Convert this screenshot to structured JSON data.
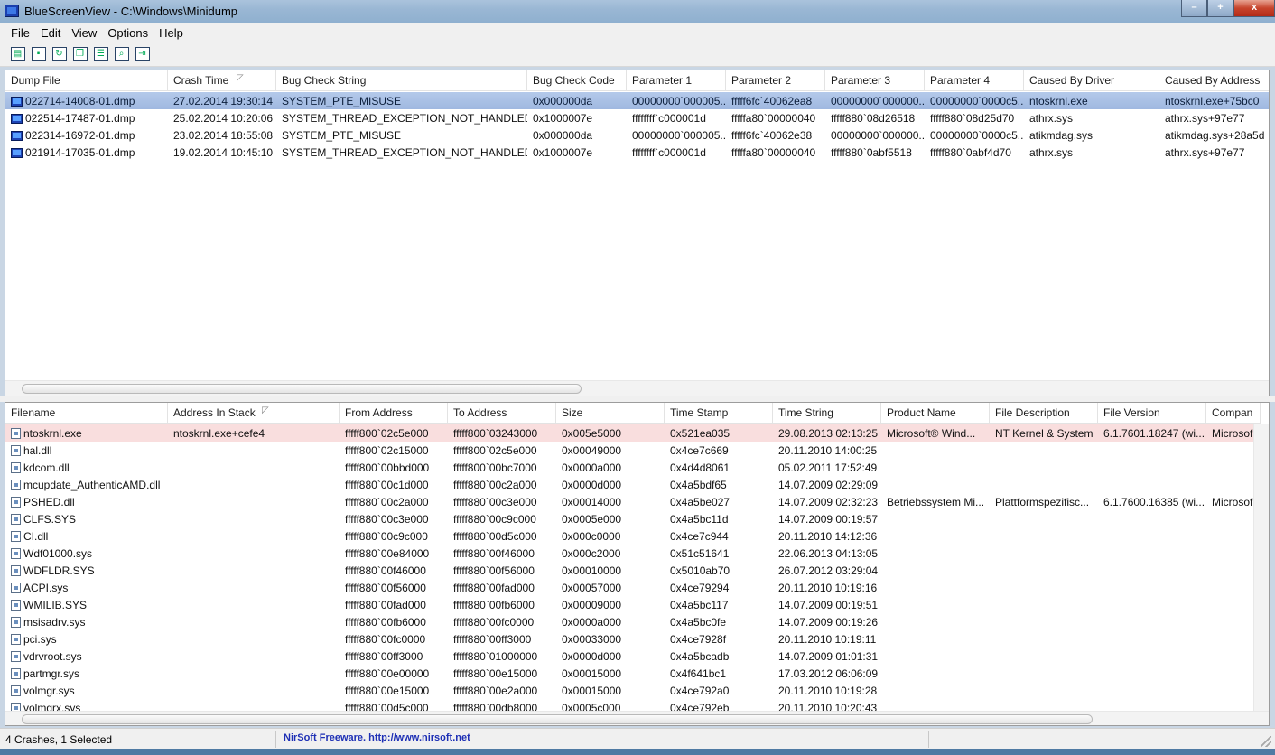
{
  "window": {
    "title": "BlueScreenView  -  C:\\Windows\\Minidump",
    "min": "–",
    "max": "+",
    "close": "x"
  },
  "menu": [
    "File",
    "Edit",
    "View",
    "Options",
    "Help"
  ],
  "toolbar": [
    {
      "name": "html-report-icon",
      "glyph": "▤"
    },
    {
      "name": "save-icon",
      "glyph": "▪"
    },
    {
      "name": "refresh-icon",
      "glyph": "↻"
    },
    {
      "name": "copy-icon",
      "glyph": "❐"
    },
    {
      "name": "properties-icon",
      "glyph": "☰"
    },
    {
      "name": "find-icon",
      "glyph": "⌕"
    },
    {
      "name": "exit-icon",
      "glyph": "⇥"
    }
  ],
  "crashes": {
    "columns": [
      "Dump File",
      "Crash Time",
      "Bug Check String",
      "Bug Check Code",
      "Parameter 1",
      "Parameter 2",
      "Parameter 3",
      "Parameter 4",
      "Caused By Driver",
      "Caused By Address"
    ],
    "rows": [
      [
        "022714-14008-01.dmp",
        "27.02.2014 19:30:14",
        "SYSTEM_PTE_MISUSE",
        "0x000000da",
        "00000000`000005...",
        "fffff6fc`40062ea8",
        "00000000`000000...",
        "00000000`0000c5...",
        "ntoskrnl.exe",
        "ntoskrnl.exe+75bc0"
      ],
      [
        "022514-17487-01.dmp",
        "25.02.2014 10:20:06",
        "SYSTEM_THREAD_EXCEPTION_NOT_HANDLED",
        "0x1000007e",
        "ffffffff`c000001d",
        "fffffa80`00000040",
        "fffff880`08d26518",
        "fffff880`08d25d70",
        "athrx.sys",
        "athrx.sys+97e77"
      ],
      [
        "022314-16972-01.dmp",
        "23.02.2014 18:55:08",
        "SYSTEM_PTE_MISUSE",
        "0x000000da",
        "00000000`000005...",
        "fffff6fc`40062e38",
        "00000000`000000...",
        "00000000`0000c5...",
        "atikmdag.sys",
        "atikmdag.sys+28a5d"
      ],
      [
        "021914-17035-01.dmp",
        "19.02.2014 10:45:10",
        "SYSTEM_THREAD_EXCEPTION_NOT_HANDLED",
        "0x1000007e",
        "ffffffff`c000001d",
        "fffffa80`00000040",
        "fffff880`0abf5518",
        "fffff880`0abf4d70",
        "athrx.sys",
        "athrx.sys+97e77"
      ]
    ]
  },
  "drivers": {
    "columns": [
      "Filename",
      "Address In Stack",
      "From Address",
      "To Address",
      "Size",
      "Time Stamp",
      "Time String",
      "Product Name",
      "File Description",
      "File Version",
      "Compan"
    ],
    "rows": [
      [
        "ntoskrnl.exe",
        "ntoskrnl.exe+cefe4",
        "fffff800`02c5e000",
        "fffff800`03243000",
        "0x005e5000",
        "0x521ea035",
        "29.08.2013 02:13:25",
        "Microsoft® Wind...",
        "NT Kernel & System",
        "6.1.7601.18247 (wi...",
        "Microsof"
      ],
      [
        "hal.dll",
        "",
        "fffff800`02c15000",
        "fffff800`02c5e000",
        "0x00049000",
        "0x4ce7c669",
        "20.11.2010 14:00:25",
        "",
        "",
        "",
        ""
      ],
      [
        "kdcom.dll",
        "",
        "fffff800`00bbd000",
        "fffff800`00bc7000",
        "0x0000a000",
        "0x4d4d8061",
        "05.02.2011 17:52:49",
        "",
        "",
        "",
        ""
      ],
      [
        "mcupdate_AuthenticAMD.dll",
        "",
        "fffff880`00c1d000",
        "fffff880`00c2a000",
        "0x0000d000",
        "0x4a5bdf65",
        "14.07.2009 02:29:09",
        "",
        "",
        "",
        ""
      ],
      [
        "PSHED.dll",
        "",
        "fffff880`00c2a000",
        "fffff880`00c3e000",
        "0x00014000",
        "0x4a5be027",
        "14.07.2009 02:32:23",
        "Betriebssystem Mi...",
        "Plattformspezifisc...",
        "6.1.7600.16385 (wi...",
        "Microsof"
      ],
      [
        "CLFS.SYS",
        "",
        "fffff880`00c3e000",
        "fffff880`00c9c000",
        "0x0005e000",
        "0x4a5bc11d",
        "14.07.2009 00:19:57",
        "",
        "",
        "",
        ""
      ],
      [
        "CI.dll",
        "",
        "fffff880`00c9c000",
        "fffff880`00d5c000",
        "0x000c0000",
        "0x4ce7c944",
        "20.11.2010 14:12:36",
        "",
        "",
        "",
        ""
      ],
      [
        "Wdf01000.sys",
        "",
        "fffff880`00e84000",
        "fffff880`00f46000",
        "0x000c2000",
        "0x51c51641",
        "22.06.2013 04:13:05",
        "",
        "",
        "",
        ""
      ],
      [
        "WDFLDR.SYS",
        "",
        "fffff880`00f46000",
        "fffff880`00f56000",
        "0x00010000",
        "0x5010ab70",
        "26.07.2012 03:29:04",
        "",
        "",
        "",
        ""
      ],
      [
        "ACPI.sys",
        "",
        "fffff880`00f56000",
        "fffff880`00fad000",
        "0x00057000",
        "0x4ce79294",
        "20.11.2010 10:19:16",
        "",
        "",
        "",
        ""
      ],
      [
        "WMILIB.SYS",
        "",
        "fffff880`00fad000",
        "fffff880`00fb6000",
        "0x00009000",
        "0x4a5bc117",
        "14.07.2009 00:19:51",
        "",
        "",
        "",
        ""
      ],
      [
        "msisadrv.sys",
        "",
        "fffff880`00fb6000",
        "fffff880`00fc0000",
        "0x0000a000",
        "0x4a5bc0fe",
        "14.07.2009 00:19:26",
        "",
        "",
        "",
        ""
      ],
      [
        "pci.sys",
        "",
        "fffff880`00fc0000",
        "fffff880`00ff3000",
        "0x00033000",
        "0x4ce7928f",
        "20.11.2010 10:19:11",
        "",
        "",
        "",
        ""
      ],
      [
        "vdrvroot.sys",
        "",
        "fffff880`00ff3000",
        "fffff880`01000000",
        "0x0000d000",
        "0x4a5bcadb",
        "14.07.2009 01:01:31",
        "",
        "",
        "",
        ""
      ],
      [
        "partmgr.sys",
        "",
        "fffff880`00e00000",
        "fffff880`00e15000",
        "0x00015000",
        "0x4f641bc1",
        "17.03.2012 06:06:09",
        "",
        "",
        "",
        ""
      ],
      [
        "volmgr.sys",
        "",
        "fffff880`00e15000",
        "fffff880`00e2a000",
        "0x00015000",
        "0x4ce792a0",
        "20.11.2010 10:19:28",
        "",
        "",
        "",
        ""
      ],
      [
        "volmgrx.sys",
        "",
        "fffff880`00d5c000",
        "fffff880`00db8000",
        "0x0005c000",
        "0x4ce792eb",
        "20.11.2010 10:20:43",
        "",
        "",
        "",
        ""
      ]
    ]
  },
  "status": {
    "count": "4 Crashes, 1 Selected",
    "credit": "NirSoft Freeware.  http://www.nirsoft.net"
  }
}
